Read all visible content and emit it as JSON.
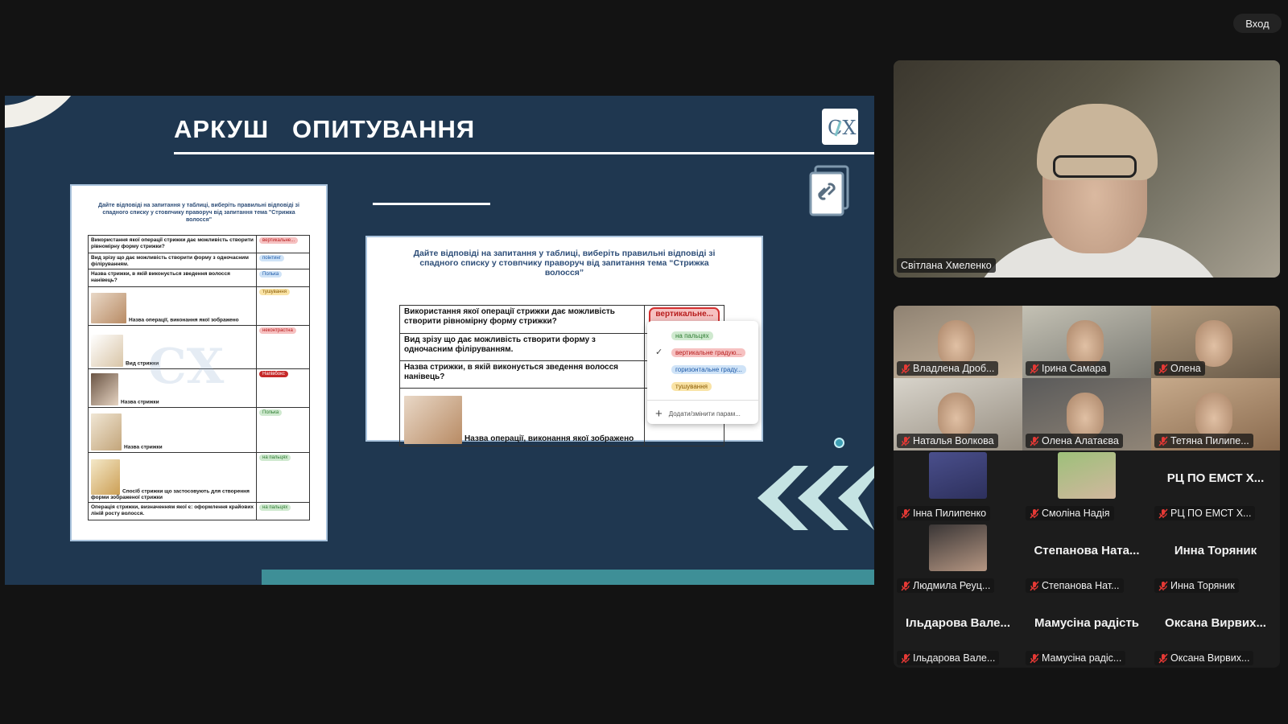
{
  "topbar": {
    "enter_label": "Вход"
  },
  "slide": {
    "title": "АРКУШ   ОПИТУВАННЯ",
    "logo_text": "СХ",
    "left_doc": {
      "heading": "Дайте відповіді на запитання у таблиці, виберіть правильні відповіді зі спадного списку у стовпчику праворуч від запитання тема \"Стрижка волосся\"",
      "rows": [
        {
          "q": "Використання якої операції стрижки дає можливість створити рівномірну форму стрижки?",
          "a": "вертикальне..."
        },
        {
          "q": "Вид зрізу що дає можливість створити форму з одночасним філіруванням.",
          "a": "поінтинг"
        },
        {
          "q": "Назва стрижки, в якій виконується зведення волосся нанівець?",
          "a": "Полька"
        },
        {
          "q": "Назва операції, виконання якої зображено",
          "a": "тушування"
        },
        {
          "q": "Вид стрижки",
          "a": "неконтрастна"
        },
        {
          "q": "Назва стрижки",
          "a": "Напівбокс"
        },
        {
          "q": "Назва стрижки",
          "a": "Полька"
        },
        {
          "q": "Спосіб стрижки що застосовують для створення форми зображеної стрижки",
          "a": "на пальцях"
        },
        {
          "q": "Операція стрижки, визначенням якої є: оформлення крайових ліній росту волосся.",
          "a": "на пальцях"
        }
      ]
    },
    "mid_doc": {
      "heading": "Дайте відповіді на запитання у таблиці, виберіть правильні відповіді зі спадного списку у стовпчику праворуч від запитання тема “Стрижка волосся”",
      "rows": [
        {
          "q": "Використання якої операції стрижки дає можливість створити рівномірну форму стрижки?",
          "a": "вертикальне..."
        },
        {
          "q": "Вид зрізу що дає можливість створити форму з одночасним філіруванням.",
          "a": ""
        },
        {
          "q": "Назва стрижки, в якій виконується зведення волосся нанівець?",
          "a": ""
        },
        {
          "q": "Назва операції, виконання якої зображено",
          "a": ""
        }
      ],
      "dropdown": {
        "options": [
          "на пальцях",
          "вертикальне градую...",
          "горизонтальне граду...",
          "тушування"
        ],
        "selected_index": 1,
        "add_label": "Додати/змінити парам..."
      }
    }
  },
  "speaker": {
    "name": "Світлана Хмеленко"
  },
  "participants": [
    {
      "name": "Владлена Дроб...",
      "video": true,
      "style": "video"
    },
    {
      "name": "Ірина Самара",
      "video": true,
      "style": "v2"
    },
    {
      "name": "Олена",
      "video": true,
      "style": "v3"
    },
    {
      "name": "Наталья Волкова",
      "video": true,
      "style": "v4"
    },
    {
      "name": "Олена Алатаєва",
      "video": true,
      "style": "v5"
    },
    {
      "name": "Тетяна Пилипе...",
      "video": true,
      "style": "v6"
    },
    {
      "name": "Інна Пилипенко",
      "avatar": true,
      "avatar_style": ""
    },
    {
      "name": "Смоліна Надія",
      "avatar": true,
      "avatar_style": "green"
    },
    {
      "name": "РЦ ПО ЕМСТ Х...",
      "big": "РЦ ПО ЕМСТ Х..."
    },
    {
      "name": "Людмила Реуц...",
      "avatar": true,
      "avatar_style": "dark"
    },
    {
      "name": "Степанова Нат...",
      "big": "Степанова  Ната..."
    },
    {
      "name": "Инна Торяник",
      "big": "Инна Торяник"
    },
    {
      "name": "Ільдарова Вале...",
      "big": "Ільдарова  Вале..."
    },
    {
      "name": "Мамусіна радіс...",
      "big": "Мамусіна радість"
    },
    {
      "name": "Оксана Вирвих...",
      "big": "Оксана  Вирвих..."
    }
  ],
  "colors": {
    "slide_bg": "#1f3750",
    "accent_teal": "#3e8f97",
    "chip_red": "#f6c1c1"
  }
}
